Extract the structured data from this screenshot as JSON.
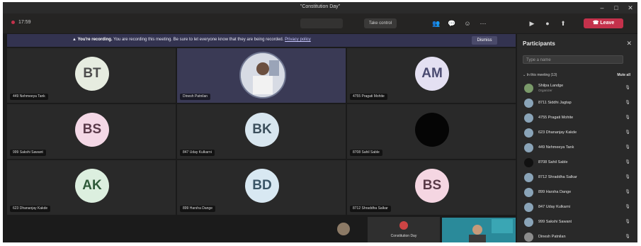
{
  "window": {
    "title": "\"Constitution Day\"",
    "min": "–",
    "max": "□",
    "close": "✕"
  },
  "toolbar": {
    "timer": "17:59",
    "take_control": "Take control",
    "leave": "Leave",
    "icons": [
      "people-icon",
      "chat-icon",
      "reactions-icon",
      "more-icon",
      "camera-icon",
      "mic-icon",
      "share-icon"
    ]
  },
  "banner": {
    "bold": "You're recording.",
    "text": " You are recording this meeting. Be sure to let everyone know that they are being recorded.",
    "link": "Privacy policy",
    "dismiss": "Dismiss"
  },
  "tiles": [
    {
      "initials": "BT",
      "name": "449 Nehmeeya Tank",
      "bg": "#e6ece0",
      "fg": "#4d4d4d"
    },
    {
      "initials": "",
      "name": "Dinesh Patnilan",
      "photo": true
    },
    {
      "initials": "AM",
      "name": "4755 Pragati Mohite",
      "bg": "#e4e0f2",
      "fg": "#4a4a70"
    },
    {
      "initials": "BS",
      "name": "999 Sakshi Sawant",
      "bg": "#f4d8e6",
      "fg": "#5a3a4a"
    },
    {
      "initials": "BK",
      "name": "847 Uday Kulkarni",
      "bg": "#d8e6ef",
      "fg": "#3c4f5c"
    },
    {
      "initials": "",
      "name": "8708 Sahil Sable",
      "bg": "#050505",
      "fg": "#050505"
    },
    {
      "initials": "AK",
      "name": "623 Dhananjay Kakde",
      "bg": "#dcefdf",
      "fg": "#2f5a3a"
    },
    {
      "initials": "BD",
      "name": "899 Harsha Dange",
      "bg": "#d8e8f2",
      "fg": "#3a5566"
    },
    {
      "initials": "BS",
      "name": "8712 Shraddha Salkar",
      "bg": "#f5d6e2",
      "fg": "#5a3a48"
    }
  ],
  "bottom": {
    "presenter_name": "Constitution Day"
  },
  "panel": {
    "title": "Participants",
    "search_placeholder": "Type a name",
    "section": "In this meeting (13)",
    "mute_all": "Mute all",
    "participants": [
      {
        "name": "Shilpa Landge",
        "role": "Organizer",
        "color": "#7a9a6a"
      },
      {
        "name": "8711 Siddhi Jagtap",
        "role": "",
        "color": "#8aa4b8"
      },
      {
        "name": "4755 Pragati Mohite",
        "role": "",
        "color": "#8aa4b8"
      },
      {
        "name": "623 Dhananjay Kakde",
        "role": "",
        "color": "#8aa4b8"
      },
      {
        "name": "449 Nehmeeya Tank",
        "role": "",
        "color": "#8aa4b8"
      },
      {
        "name": "8708 Sahil Sable",
        "role": "",
        "color": "#111111"
      },
      {
        "name": "8712 Shraddha Salkar",
        "role": "",
        "color": "#8aa4b8"
      },
      {
        "name": "899 Harsha Dange",
        "role": "",
        "color": "#8aa4b8"
      },
      {
        "name": "847 Uday Kulkarni",
        "role": "",
        "color": "#8aa4b8"
      },
      {
        "name": "999 Sakshi Sawant",
        "role": "",
        "color": "#8aa4b8"
      },
      {
        "name": "Dinesh Patnilan",
        "role": "",
        "color": "#8c8c8c"
      }
    ]
  }
}
